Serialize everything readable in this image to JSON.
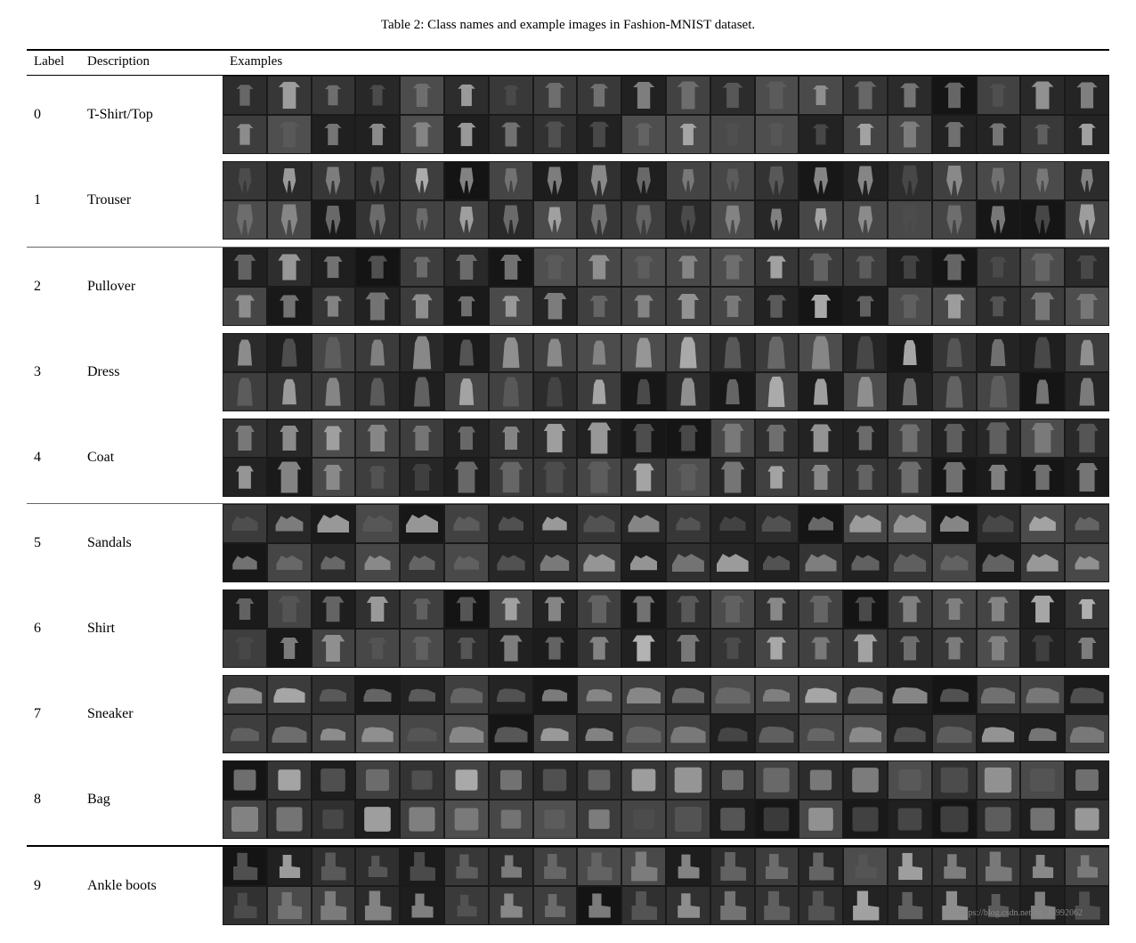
{
  "title": "Table 2: Class names and example images in Fashion-MNIST dataset.",
  "table": {
    "columns": [
      "Label",
      "Description",
      "Examples"
    ],
    "rows": [
      {
        "label": "0",
        "description": "T-Shirt/Top",
        "shape": "tshirt"
      },
      {
        "label": "1",
        "description": "Trouser",
        "shape": "trouser"
      },
      {
        "label": "2",
        "description": "Pullover",
        "shape": "pullover"
      },
      {
        "label": "3",
        "description": "Dress",
        "shape": "dress"
      },
      {
        "label": "4",
        "description": "Coat",
        "shape": "coat"
      },
      {
        "label": "5",
        "description": "Sandals",
        "shape": "sandal"
      },
      {
        "label": "6",
        "description": "Shirt",
        "shape": "shirt"
      },
      {
        "label": "7",
        "description": "Sneaker",
        "shape": "sneaker"
      },
      {
        "label": "8",
        "description": "Bag",
        "shape": "bag"
      },
      {
        "label": "9",
        "description": "Ankle boots",
        "shape": "boot"
      }
    ]
  },
  "watermark": "https://blog.csdn.net/qq_46992062"
}
